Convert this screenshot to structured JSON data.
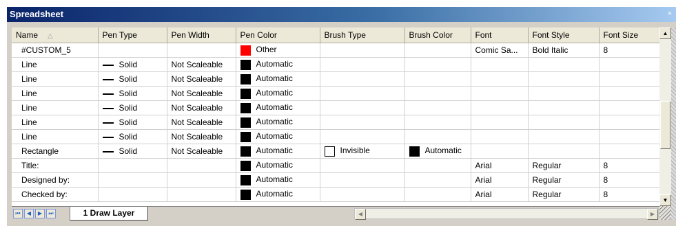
{
  "window": {
    "title": "Spreadsheet",
    "close_glyph": "×"
  },
  "columns": [
    {
      "label": "Name",
      "sort": "△"
    },
    {
      "label": "Pen Type"
    },
    {
      "label": "Pen Width"
    },
    {
      "label": "Pen Color"
    },
    {
      "label": "Brush Type"
    },
    {
      "label": "Brush Color"
    },
    {
      "label": "Font"
    },
    {
      "label": "Font Style"
    },
    {
      "label": "Font Size"
    }
  ],
  "rows": [
    {
      "name": "#CUSTOM_5",
      "pen_type": "",
      "pen_width": "",
      "pen_color": "Other",
      "pen_color_swatch": "#ff0000",
      "brush_type": "",
      "brush_color": "",
      "font": "Comic Sa...",
      "font_style": "Bold Italic",
      "font_size": "8"
    },
    {
      "name": "Line",
      "pen_type": "Solid",
      "pen_width": "Not Scaleable",
      "pen_color": "Automatic",
      "pen_color_swatch": "#000000",
      "brush_type": "",
      "brush_color": "",
      "font": "",
      "font_style": "",
      "font_size": ""
    },
    {
      "name": "Line",
      "pen_type": "Solid",
      "pen_width": "Not Scaleable",
      "pen_color": "Automatic",
      "pen_color_swatch": "#000000",
      "brush_type": "",
      "brush_color": "",
      "font": "",
      "font_style": "",
      "font_size": ""
    },
    {
      "name": "Line",
      "pen_type": "Solid",
      "pen_width": "Not Scaleable",
      "pen_color": "Automatic",
      "pen_color_swatch": "#000000",
      "brush_type": "",
      "brush_color": "",
      "font": "",
      "font_style": "",
      "font_size": ""
    },
    {
      "name": "Line",
      "pen_type": "Solid",
      "pen_width": "Not Scaleable",
      "pen_color": "Automatic",
      "pen_color_swatch": "#000000",
      "brush_type": "",
      "brush_color": "",
      "font": "",
      "font_style": "",
      "font_size": ""
    },
    {
      "name": "Line",
      "pen_type": "Solid",
      "pen_width": "Not Scaleable",
      "pen_color": "Automatic",
      "pen_color_swatch": "#000000",
      "brush_type": "",
      "brush_color": "",
      "font": "",
      "font_style": "",
      "font_size": ""
    },
    {
      "name": "Line",
      "pen_type": "Solid",
      "pen_width": "Not Scaleable",
      "pen_color": "Automatic",
      "pen_color_swatch": "#000000",
      "brush_type": "",
      "brush_color": "",
      "font": "",
      "font_style": "",
      "font_size": ""
    },
    {
      "name": "Rectangle",
      "pen_type": "Solid",
      "pen_width": "Not Scaleable",
      "pen_color": "Automatic",
      "pen_color_swatch": "#000000",
      "brush_type": "Invisible",
      "brush_type_swatch": "#ffffff",
      "brush_color": "Automatic",
      "brush_color_swatch": "#000000",
      "font": "",
      "font_style": "",
      "font_size": ""
    },
    {
      "name": "Title:",
      "pen_type": "",
      "pen_width": "",
      "pen_color": "Automatic",
      "pen_color_swatch": "#000000",
      "brush_type": "",
      "brush_color": "",
      "font": "Arial",
      "font_style": "Regular",
      "font_size": "8"
    },
    {
      "name": "Designed by:",
      "pen_type": "",
      "pen_width": "",
      "pen_color": "Automatic",
      "pen_color_swatch": "#000000",
      "brush_type": "",
      "brush_color": "",
      "font": "Arial",
      "font_style": "Regular",
      "font_size": "8"
    },
    {
      "name": "Checked by:",
      "pen_type": "",
      "pen_width": "",
      "pen_color": "Automatic",
      "pen_color_swatch": "#000000",
      "brush_type": "",
      "brush_color": "",
      "font": "Arial",
      "font_style": "Regular",
      "font_size": "8"
    }
  ],
  "sheet_tab": {
    "label": "1 Draw Layer"
  },
  "nav_glyphs": [
    "⏮",
    "◀",
    "▶",
    "⏭"
  ],
  "scroll_glyphs": {
    "up": "▲",
    "down": "▼",
    "left": "◀",
    "right": "▶"
  },
  "colors": {
    "title_start": "#0a246a",
    "title_end": "#a6caf0",
    "header_bg": "#ece9d8",
    "frame": "#d4d0c8"
  }
}
